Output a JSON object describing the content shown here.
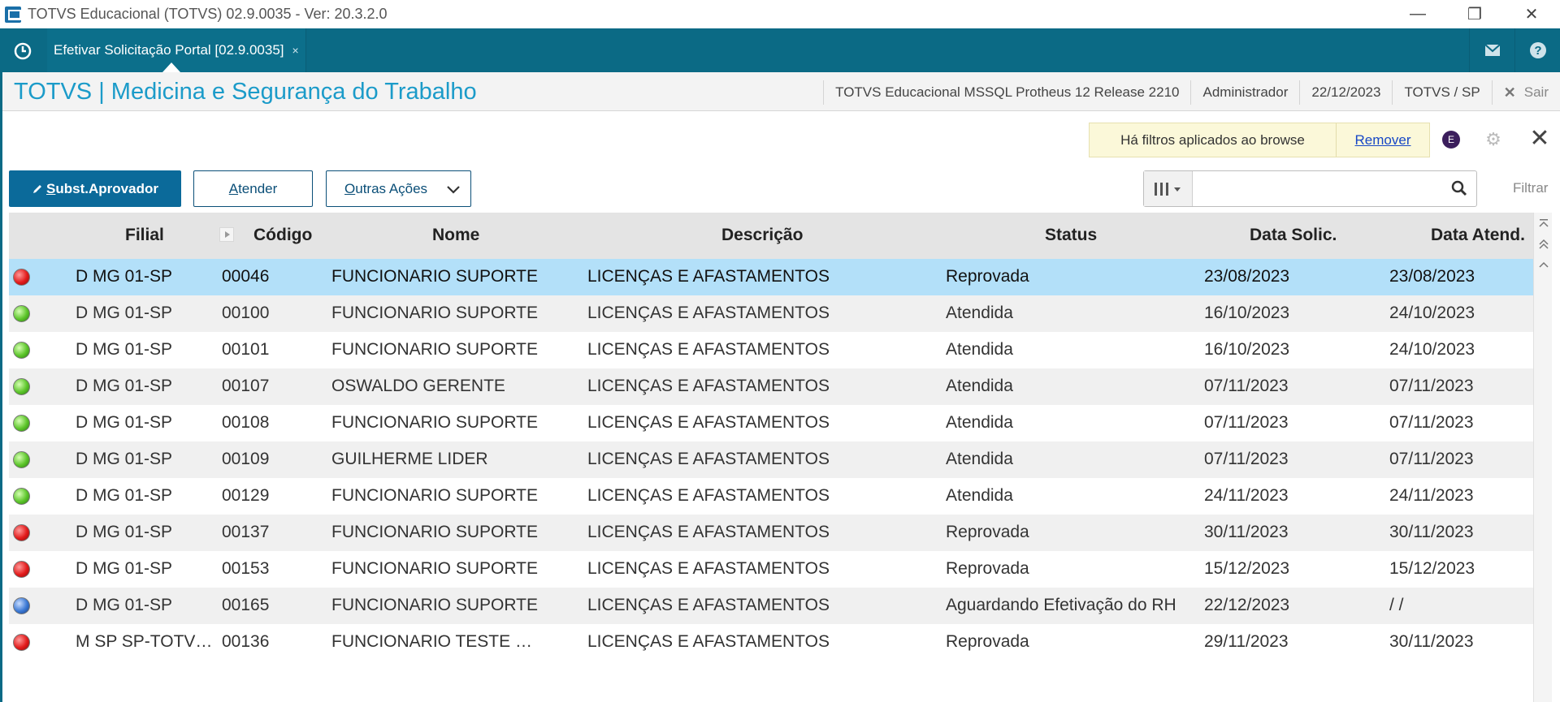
{
  "window": {
    "title": "TOTVS Educacional (TOTVS) 02.9.0035 - Ver: 20.3.2.0",
    "minimize": "—",
    "restore": "❐",
    "close": "✕"
  },
  "tabbar": {
    "tab_label": "Efetivar Solicitação Portal [02.9.0035]",
    "tab_close": "×"
  },
  "header": {
    "module_title": "TOTVS | Medicina e Segurança do Trabalho",
    "environment": "TOTVS Educacional MSSQL Protheus 12 Release 2210",
    "user": "Administrador",
    "date": "22/12/2023",
    "branch": "TOTVS / SP",
    "exit_label": "Sair"
  },
  "filter_notice": {
    "text": "Há filtros aplicados ao browse",
    "remove_label": "Remover",
    "badge": "E"
  },
  "actions": {
    "primary_prefix": "S",
    "primary_rest": "ubst.Aprovador",
    "atender_prefix": "A",
    "atender_rest": "tender",
    "outras_prefix": "O",
    "outras_rest": "utras Ações"
  },
  "search": {
    "value": "",
    "filter_label": "Filtrar"
  },
  "grid": {
    "columns": [
      "Filial",
      "Código",
      "Nome",
      "Descrição",
      "Status",
      "Data Solic.",
      "Data Atend."
    ],
    "rows": [
      {
        "status_color": "red",
        "filial": "D MG 01-SP",
        "codigo": "00046",
        "nome": "FUNCIONARIO SUPORTE",
        "descricao": "LICENÇAS E AFASTAMENTOS",
        "status": "Reprovada",
        "data_solic": "23/08/2023",
        "data_atend": "23/08/2023"
      },
      {
        "status_color": "green",
        "filial": "D MG 01-SP",
        "codigo": "00100",
        "nome": "FUNCIONARIO SUPORTE",
        "descricao": "LICENÇAS E AFASTAMENTOS",
        "status": "Atendida",
        "data_solic": "16/10/2023",
        "data_atend": "24/10/2023"
      },
      {
        "status_color": "green",
        "filial": "D MG 01-SP",
        "codigo": "00101",
        "nome": "FUNCIONARIO SUPORTE",
        "descricao": "LICENÇAS E AFASTAMENTOS",
        "status": "Atendida",
        "data_solic": "16/10/2023",
        "data_atend": "24/10/2023"
      },
      {
        "status_color": "green",
        "filial": "D MG 01-SP",
        "codigo": "00107",
        "nome": "OSWALDO GERENTE",
        "descricao": "LICENÇAS E AFASTAMENTOS",
        "status": "Atendida",
        "data_solic": "07/11/2023",
        "data_atend": "07/11/2023"
      },
      {
        "status_color": "green",
        "filial": "D MG 01-SP",
        "codigo": "00108",
        "nome": "FUNCIONARIO SUPORTE",
        "descricao": "LICENÇAS E AFASTAMENTOS",
        "status": "Atendida",
        "data_solic": "07/11/2023",
        "data_atend": "07/11/2023"
      },
      {
        "status_color": "green",
        "filial": "D MG 01-SP",
        "codigo": "00109",
        "nome": "GUILHERME LIDER",
        "descricao": "LICENÇAS E AFASTAMENTOS",
        "status": "Atendida",
        "data_solic": "07/11/2023",
        "data_atend": "07/11/2023"
      },
      {
        "status_color": "green",
        "filial": "D MG 01-SP",
        "codigo": "00129",
        "nome": "FUNCIONARIO SUPORTE",
        "descricao": "LICENÇAS E AFASTAMENTOS",
        "status": "Atendida",
        "data_solic": "24/11/2023",
        "data_atend": "24/11/2023"
      },
      {
        "status_color": "red",
        "filial": "D MG 01-SP",
        "codigo": "00137",
        "nome": "FUNCIONARIO SUPORTE",
        "descricao": "LICENÇAS E AFASTAMENTOS",
        "status": "Reprovada",
        "data_solic": "30/11/2023",
        "data_atend": "30/11/2023"
      },
      {
        "status_color": "red",
        "filial": "D MG 01-SP",
        "codigo": "00153",
        "nome": "FUNCIONARIO SUPORTE",
        "descricao": "LICENÇAS E AFASTAMENTOS",
        "status": "Reprovada",
        "data_solic": "15/12/2023",
        "data_atend": "15/12/2023"
      },
      {
        "status_color": "blue",
        "filial": "D MG 01-SP",
        "codigo": "00165",
        "nome": "FUNCIONARIO SUPORTE",
        "descricao": "LICENÇAS E AFASTAMENTOS",
        "status": "Aguardando Efetivação do RH",
        "data_solic": "22/12/2023",
        "data_atend": "/  /"
      },
      {
        "status_color": "red",
        "filial": "M SP SP-TOTV…",
        "codigo": "00136",
        "nome": "FUNCIONARIO TESTE …",
        "descricao": "LICENÇAS E AFASTAMENTOS",
        "status": "Reprovada",
        "data_solic": "29/11/2023",
        "data_atend": "30/11/2023"
      }
    ]
  },
  "colors": {
    "tabbar": "#0b6a85",
    "module_title": "#1b9bc9",
    "primary_button": "#0b6a9a",
    "selected_row": "#b3e0f9"
  }
}
